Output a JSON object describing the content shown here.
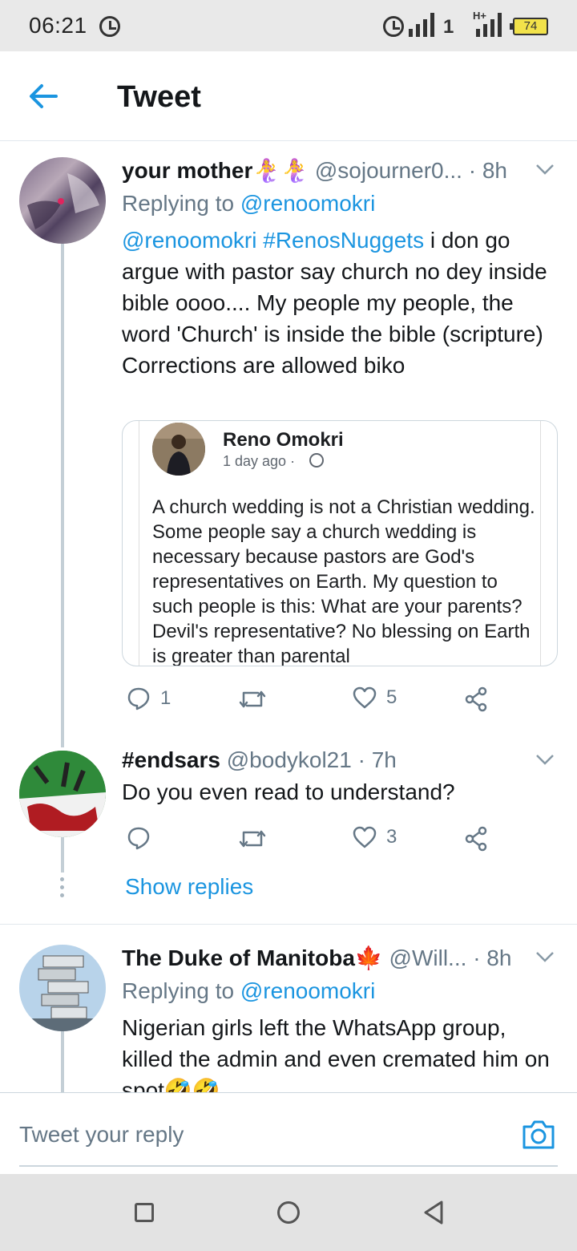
{
  "status_bar": {
    "time": "06:21",
    "network_a": "1",
    "network_b": "H+",
    "battery": "74"
  },
  "header": {
    "title": "Tweet"
  },
  "tweets": [
    {
      "name": "your mother🧜‍♀️🧜‍♀️",
      "handle": "@sojourner0...",
      "time": "· 8h",
      "replying_prefix": "Replying to ",
      "replying_to": "@renoomokri",
      "mention": "@renoomokri",
      "hashtag": "#RenosNuggets",
      "text": " i don go argue with pastor say church no dey inside bible oooo.... My people my people, the word 'Church' is inside the bible (scripture)",
      "text2": "Corrections are allowed biko",
      "reply_count": "1",
      "retweet_count": "",
      "like_count": "5",
      "embed": {
        "author": "Reno Omokri",
        "meta": "1 day ago ·",
        "text": "A church wedding is not a Christian wedding. Some people say a church wedding is necessary because pastors are God's representatives on Earth. My question to such people is this: What are your parents? Devil's representative? No blessing on Earth is greater than parental"
      }
    },
    {
      "name": "#endsars",
      "handle": "@bodykol21",
      "time": "· 7h",
      "text": "Do you even read to understand?",
      "reply_count": "",
      "retweet_count": "",
      "like_count": "3"
    },
    {
      "name": "The Duke of Manitoba🍁",
      "handle": "@Will...",
      "time": "· 8h",
      "replying_prefix": "Replying to ",
      "replying_to": "@renoomokri",
      "text": "Nigerian girls left the WhatsApp group, killed the admin and even cremated him on spot🤣🤣"
    }
  ],
  "show_replies": "Show replies",
  "reply_bar": {
    "placeholder": "Tweet your reply"
  },
  "colors": {
    "accent": "#1b95e0",
    "secondary_text": "#657786",
    "thread_line": "#c4cfd6"
  }
}
